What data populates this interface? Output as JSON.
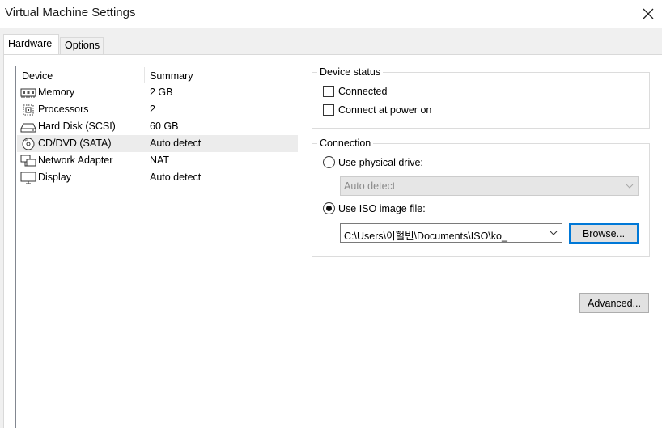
{
  "window": {
    "title": "Virtual Machine Settings"
  },
  "tabs": [
    {
      "label": "Hardware",
      "active": true
    },
    {
      "label": "Options",
      "active": false
    }
  ],
  "device_list": {
    "columns": [
      "Device",
      "Summary"
    ],
    "rows": [
      {
        "icon": "memory-icon",
        "name": "Memory",
        "summary": "2 GB"
      },
      {
        "icon": "processor-icon",
        "name": "Processors",
        "summary": "2"
      },
      {
        "icon": "hard-disk-icon",
        "name": "Hard Disk (SCSI)",
        "summary": "60 GB"
      },
      {
        "icon": "cd-dvd-icon",
        "name": "CD/DVD (SATA)",
        "summary": "Auto detect",
        "selected": true
      },
      {
        "icon": "network-adapter-icon",
        "name": "Network Adapter",
        "summary": "NAT"
      },
      {
        "icon": "display-icon",
        "name": "Display",
        "summary": "Auto detect"
      }
    ]
  },
  "device_status": {
    "legend": "Device status",
    "connected_label": "Connected",
    "connected": false,
    "connect_at_power_on_label": "Connect at power on",
    "connect_at_power_on": false
  },
  "connection": {
    "legend": "Connection",
    "physical_label": "Use physical drive:",
    "physical_selected": false,
    "physical_value": "Auto detect",
    "iso_label": "Use ISO image file:",
    "iso_selected": true,
    "iso_value": "C:\\Users\\이혈빈\\Documents\\ISO\\ko_",
    "browse_label": "Browse..."
  },
  "advanced_label": "Advanced...",
  "colors": {
    "accent": "#0078d7",
    "selected_row": "#ececec",
    "panel_bg": "#f0f0f0"
  }
}
